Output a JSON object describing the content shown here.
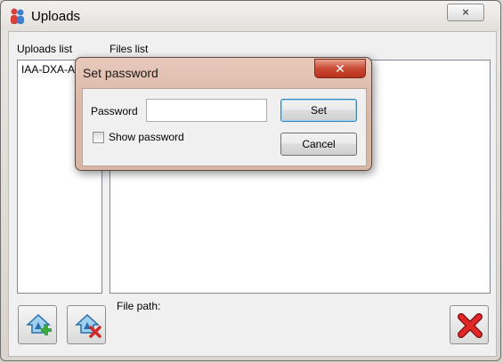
{
  "window": {
    "title": "Uploads",
    "close_icon": "×"
  },
  "uploads": {
    "label": "Uploads list",
    "items": [
      "IAA-DXA-A"
    ]
  },
  "files": {
    "label": "Files list"
  },
  "file_path": {
    "label": "File path:"
  },
  "toolbar": {
    "add_icon": "upload-add-icon",
    "remove_icon": "upload-remove-icon",
    "delete_icon": "red-x-icon"
  },
  "dialog": {
    "title": "Set password",
    "close_icon": "✕",
    "password_label": "Password",
    "password_value": "",
    "show_password_label": "Show password",
    "show_password_checked": false,
    "set_label": "Set",
    "cancel_label": "Cancel"
  },
  "colors": {
    "dialog_frame": "#dcb8a8",
    "close_red": "#c94a34",
    "default_button_border": "#3c7fb1"
  }
}
